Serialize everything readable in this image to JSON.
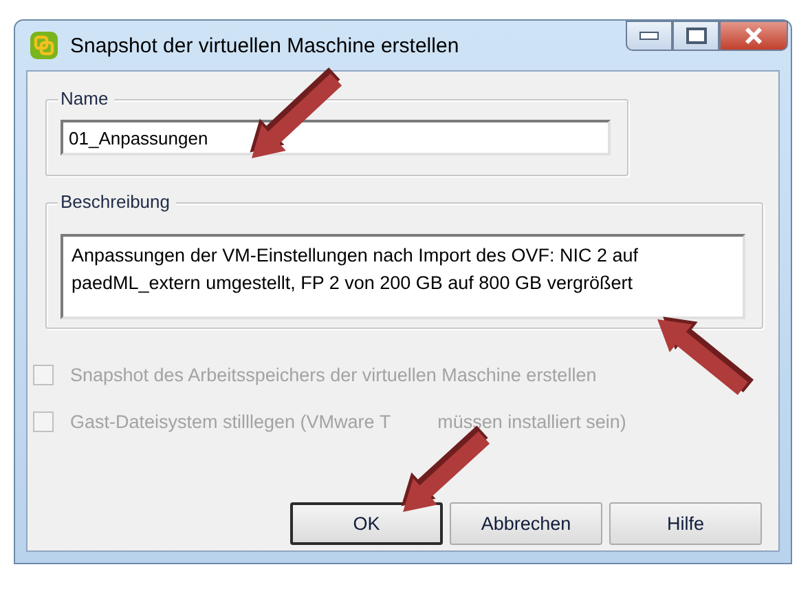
{
  "window": {
    "title": "Snapshot der virtuellen Maschine erstellen"
  },
  "name_group": {
    "legend": "Name",
    "value": "01_Anpassungen"
  },
  "description_group": {
    "legend": "Beschreibung",
    "value": "Anpassungen der VM-Einstellungen nach Import des OVF: NIC 2 auf paedML_extern umgestellt, FP 2 von 200 GB auf 800 GB vergrößert"
  },
  "checkboxes": [
    {
      "label": "Snapshot des Arbeitsspeichers der virtuellen Maschine erstellen",
      "checked": false,
      "disabled": true
    },
    {
      "label": "Gast-Dateisystem stilllegen (VMware T",
      "label_after_arrow": "müssen installiert sein)",
      "checked": false,
      "disabled": true
    }
  ],
  "buttons": [
    {
      "label": "OK",
      "default": true
    },
    {
      "label": "Abbrechen",
      "default": false
    },
    {
      "label": "Hilfe",
      "default": false
    }
  ]
}
